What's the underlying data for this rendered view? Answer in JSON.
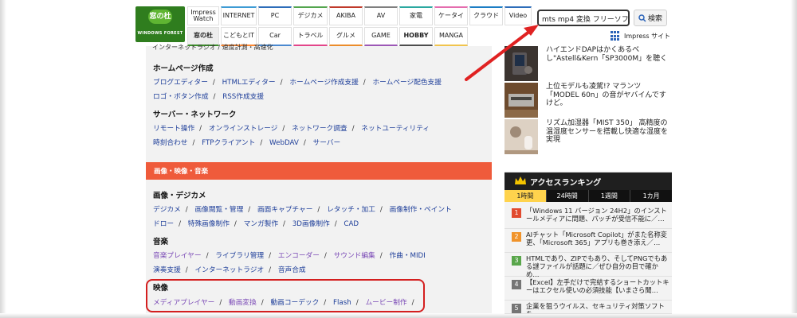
{
  "header": {
    "logo": {
      "badge": "窓の杜",
      "wordmark": "WINDOWS FOREST"
    },
    "nav_row1": [
      "Impress\nWatch",
      "INTERNET",
      "PC",
      "デジカメ",
      "AKIBA",
      "AV",
      "家電",
      "ケータイ",
      "クラウド",
      "Video"
    ],
    "nav_row2": [
      "窓の杜",
      "こどもとIT",
      "Car",
      "トラベル",
      "グルメ",
      "GAME",
      "HOBBY",
      "MANGA"
    ],
    "search": {
      "value": "mts mp4 変換 フリーソフト",
      "button": "検索",
      "site_link": "Impress サイト"
    }
  },
  "main": {
    "top_cut": "インターネットラジオ  /  速度計測・高速化",
    "sections": [
      {
        "title": "ホームページ作成",
        "rows": [
          [
            "ブログエディター",
            "HTMLエディター",
            "ホームページ作成支援",
            "ホームページ配色支援"
          ],
          [
            "ロゴ・ボタン作成",
            "RSS作成支援"
          ]
        ]
      },
      {
        "title": "サーバー・ネットワーク",
        "rows": [
          [
            "リモート操作",
            "オンラインストレージ",
            "ネットワーク調査",
            "ネットユーティリティ"
          ],
          [
            "時刻合わせ",
            "FTPクライアント",
            "WebDAV",
            "サーバー"
          ]
        ]
      },
      {
        "category_bar": "画像・映像・音楽"
      },
      {
        "title": "画像・デジカメ",
        "rows": [
          [
            "デジカメ",
            "画像閲覧・管理",
            "画面キャプチャー",
            "レタッチ・加工",
            "画像制作・ペイント"
          ],
          [
            "ドロー",
            "特殊画像制作",
            "マンガ製作",
            "3D画像制作",
            "CAD"
          ]
        ]
      },
      {
        "title": "音楽",
        "rows": [
          [
            "音楽プレイヤー",
            "ライブラリ管理",
            "エンコーダー",
            "サウンド編集",
            "作曲・MIDI"
          ],
          [
            "演奏支援",
            "インターネットラジオ",
            "音声合成"
          ]
        ]
      },
      {
        "title": "映像",
        "rows": [
          [
            "メディアプレイヤー",
            "動画変換",
            "動画コーデック",
            "Flash",
            "ムービー制作"
          ]
        ]
      }
    ]
  },
  "right": {
    "news": [
      {
        "title": "ハイエンドDAPはかくあるべし\"Astell&Kern「SP3000M」を聴く"
      },
      {
        "title": "上位モデルも凌駕!? マランツ「MODEL 60n」の音がヤバイんですけど。"
      },
      {
        "title": "リズム加湿器「MIST 350」 高精度の温湿度センサーを搭載し快適な湿度を実現"
      }
    ],
    "ranking": {
      "title": "アクセスランキング",
      "tabs": [
        "1時間",
        "24時間",
        "1週間",
        "1カ月"
      ],
      "items": [
        {
          "num": "1",
          "color": "#e14a2f",
          "text": "「Windows 11 バージョン 24H2」のインストールメディアに問題、パッチが受信不能に／…"
        },
        {
          "num": "2",
          "color": "#f0932a",
          "text": "AIチャット「Microsoft Copilot」がまた名称変更、「Microsoft 365」アプリも巻き添え／…"
        },
        {
          "num": "3",
          "color": "#59a64b",
          "text": "HTMLであり、ZIPでもあり、そしてPNGでもある謎ファイルが話題に／ぜひ自分の目で確かめ…"
        },
        {
          "num": "4",
          "color": "#757575",
          "text": "【Excel】左手だけで完結するショートカットキーはエクセル使いの必須技能【いまさら聞…"
        },
        {
          "num": "5",
          "color": "#757575",
          "text": "企業を狙うウイルス、セキュリティ対策ソフトを…"
        }
      ]
    }
  },
  "colors": {
    "brand_green": "#2f7d1e",
    "category_orange": "#ef5b3b",
    "link_blue": "#1f3f9a",
    "link_visited": "#7a49b6",
    "highlight_red": "#d41f1f"
  }
}
